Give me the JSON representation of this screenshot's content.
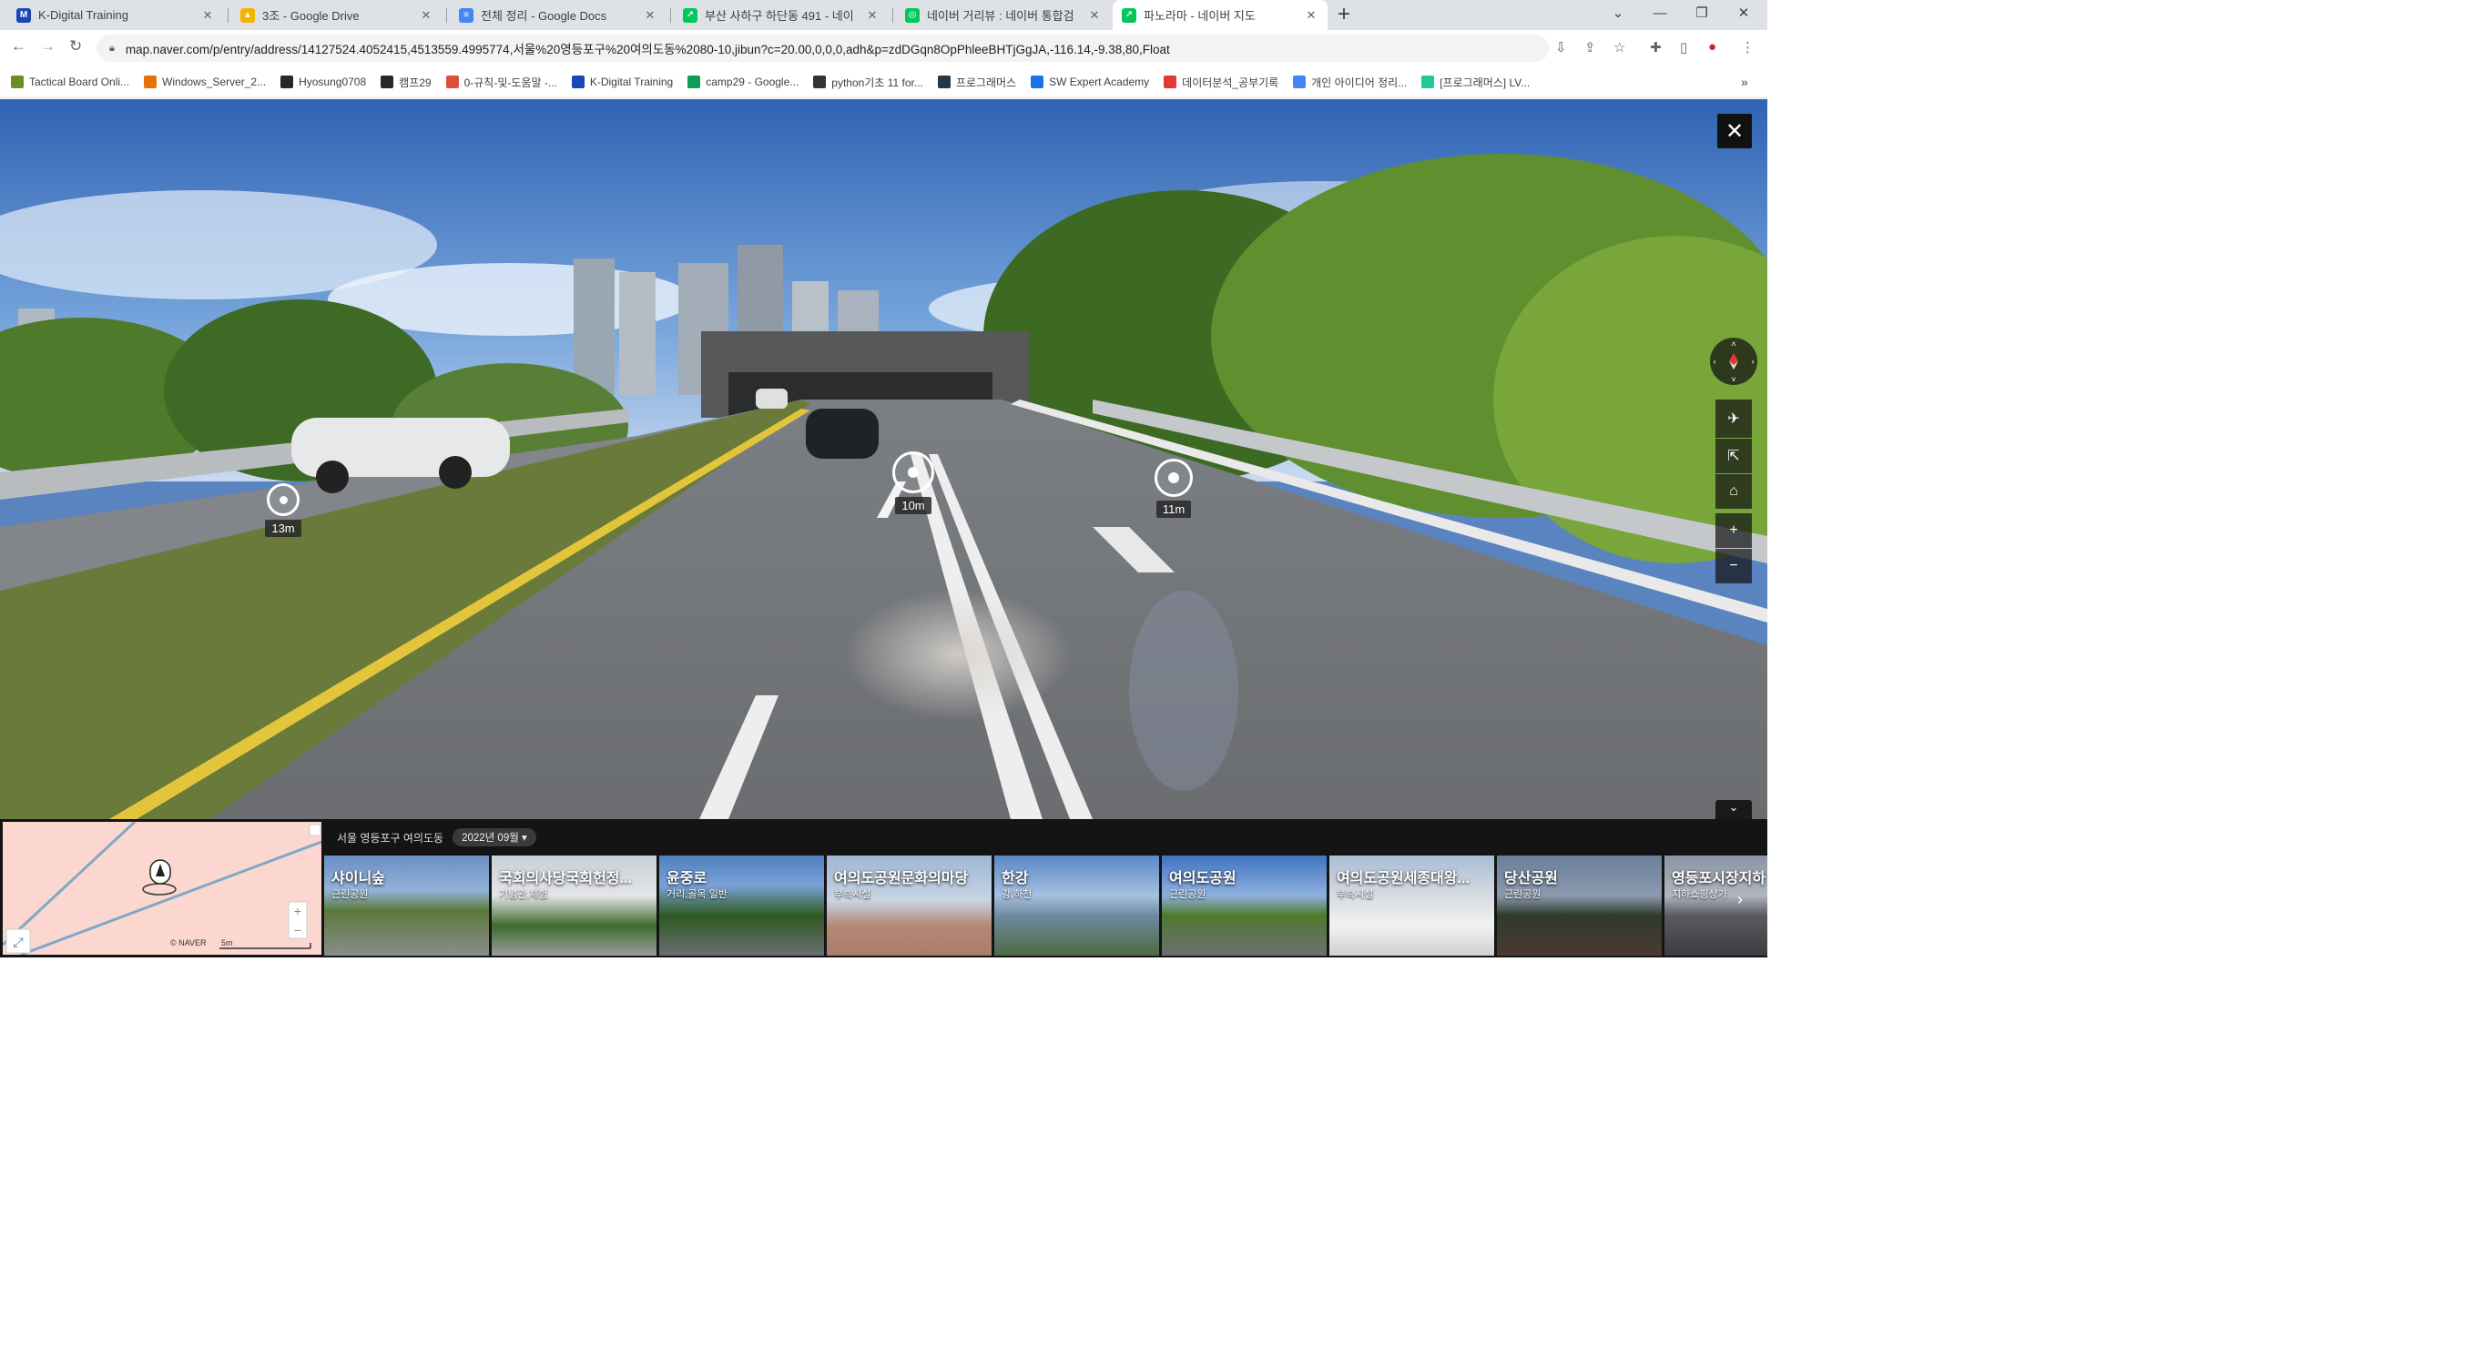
{
  "tabs": [
    {
      "title": "K-Digital Training",
      "favicon_color": "#1a47b5",
      "favicon_letter": "M"
    },
    {
      "title": "3조 - Google Drive",
      "favicon_color": "#f4b400",
      "favicon_letter": "▲"
    },
    {
      "title": "전체 정리 - Google Docs",
      "favicon_color": "#4285f4",
      "favicon_letter": "≡"
    },
    {
      "title": "부산 사하구 하단동 491 - 네이",
      "favicon_color": "#03c75a",
      "favicon_letter": "↗"
    },
    {
      "title": "네이버 거리뷰 : 네이버 통합검",
      "favicon_color": "#03c75a",
      "favicon_letter": "◎"
    },
    {
      "title": "파노라마 - 네이버 지도",
      "favicon_color": "#03c75a",
      "favicon_letter": "↗",
      "active": true
    }
  ],
  "url": "map.naver.com/p/entry/address/14127524.4052415,4513559.4995774,서울%20영등포구%20여의도동%2080-10,jibun?c=20.00,0,0,0,adh&p=zdDGqn8OpPhleeBHTjGgJA,-116.14,-9.38,80,Float",
  "bookmarks": [
    {
      "label": "Tactical Board Onli...",
      "color": "#6b8e23"
    },
    {
      "label": "Windows_Server_2...",
      "color": "#e8710a"
    },
    {
      "label": "Hyosung0708",
      "color": "#24292e"
    },
    {
      "label": "캠프29",
      "color": "#24292e"
    },
    {
      "label": "0-규칙-및-도움말 -...",
      "color": "#e04e39"
    },
    {
      "label": "K-Digital Training",
      "color": "#1a47b5"
    },
    {
      "label": "camp29 - Google...",
      "color": "#0f9d58"
    },
    {
      "label": "python기초 11 for...",
      "color": "#333333"
    },
    {
      "label": "프로그래머스",
      "color": "#263747"
    },
    {
      "label": "SW Expert Academy",
      "color": "#1a73e8"
    },
    {
      "label": "데이터분석_공부기록",
      "color": "#e53935"
    },
    {
      "label": "개인 아이디어 정리...",
      "color": "#4285f4"
    },
    {
      "label": "[프로그래머스] LV...",
      "color": "#20c997"
    }
  ],
  "bookmarks_more": "»",
  "pano": {
    "close": "✕",
    "markers": [
      {
        "label": "13m"
      },
      {
        "label": "10m"
      },
      {
        "label": "11m"
      }
    ],
    "controls": {
      "airplane": "✈",
      "share": "⇱",
      "cctv": "⌂",
      "zoom_in": "+",
      "zoom_out": "−"
    },
    "collapse": "⌄"
  },
  "location_text": "서울 영등포구 여의도동",
  "year_selector": "2022년 09월 ▾",
  "minimap": {
    "brand": "© NAVER",
    "scale": "5m"
  },
  "thumbnails": [
    {
      "name": "샤이니숲",
      "category": "근린공원"
    },
    {
      "name": "국회의사당국회헌정...",
      "category": "기념관,체험"
    },
    {
      "name": "윤중로",
      "category": "거리,골목 일반"
    },
    {
      "name": "여의도공원문화의마당",
      "category": "부속시설"
    },
    {
      "name": "한강",
      "category": "강,하천"
    },
    {
      "name": "여의도공원",
      "category": "근린공원"
    },
    {
      "name": "여의도공원세종대왕...",
      "category": "부속시설"
    },
    {
      "name": "당산공원",
      "category": "근린공원"
    },
    {
      "name": "영등포시장지하",
      "category": "지하쇼핑상가"
    }
  ]
}
